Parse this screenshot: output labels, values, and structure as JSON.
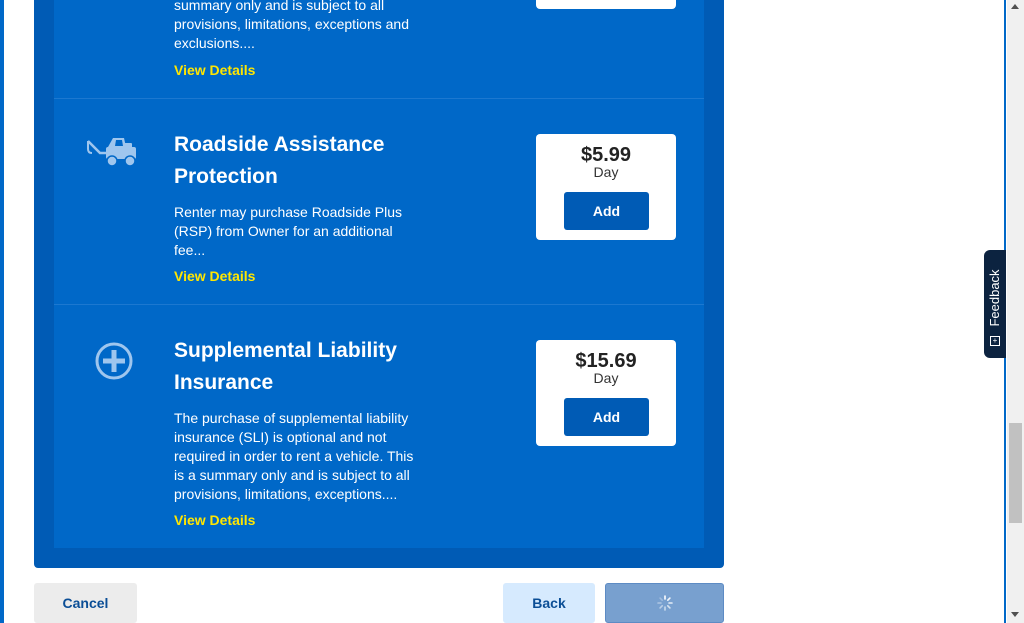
{
  "products": [
    {
      "id": "partial",
      "description": "summary only and is subject to all provisions, limitations, exceptions and exclusions....",
      "link_label": "View Details"
    },
    {
      "id": "roadside",
      "icon": "tow-truck-icon",
      "title": "Roadside Assistance Protection",
      "description": "Renter may purchase Roadside Plus (RSP) from Owner for an additional fee...",
      "link_label": "View Details",
      "price": "$5.99",
      "period": "Day",
      "add_label": "Add"
    },
    {
      "id": "sli",
      "icon": "plus-circle-icon",
      "title": "Supplemental Liability Insurance",
      "description": "The purchase of supplemental liability insurance (SLI) is optional and not required in order to rent a vehicle. This is a summary only and is subject to all provisions, limitations, exceptions....",
      "link_label": "View Details",
      "price": "$15.69",
      "period": "Day",
      "add_label": "Add"
    }
  ],
  "footer": {
    "cancel_label": "Cancel",
    "back_label": "Back",
    "continue_state": "loading-spinner-icon"
  },
  "feedback_tab": {
    "label": "Feedback",
    "icon": "expand-icon"
  },
  "colors": {
    "panel": "#005bb5",
    "product_bg": "#0068c8",
    "link": "#ffe600",
    "add_button": "#005bb5",
    "feedback_tab": "#0c2340"
  }
}
